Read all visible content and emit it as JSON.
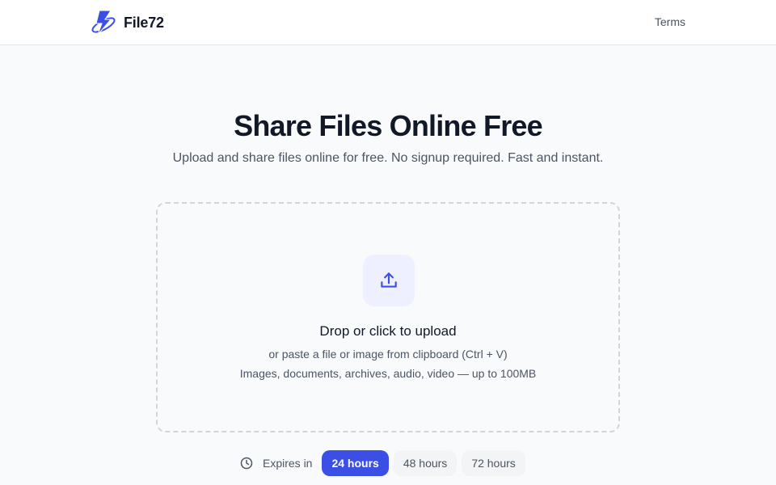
{
  "header": {
    "brand_name": "File72",
    "nav_terms": "Terms"
  },
  "hero": {
    "title": "Share Files Online Free",
    "subtitle": "Upload and share files online for free. No signup required. Fast and instant."
  },
  "dropzone": {
    "icon": "upload-icon",
    "title": "Drop or click to upload",
    "hint": "or paste a file or image from clipboard (Ctrl + V)",
    "types": "Images, documents, archives, audio, video — up to 100MB"
  },
  "expiry": {
    "icon": "clock-icon",
    "label": "Expires in",
    "options": [
      {
        "label": "24 hours",
        "selected": true
      },
      {
        "label": "48 hours",
        "selected": false
      },
      {
        "label": "72 hours",
        "selected": false
      }
    ]
  },
  "colors": {
    "accent": "#3b4fe4",
    "background": "#f9fafb",
    "text": "#111827",
    "muted_text": "#4b5563"
  }
}
